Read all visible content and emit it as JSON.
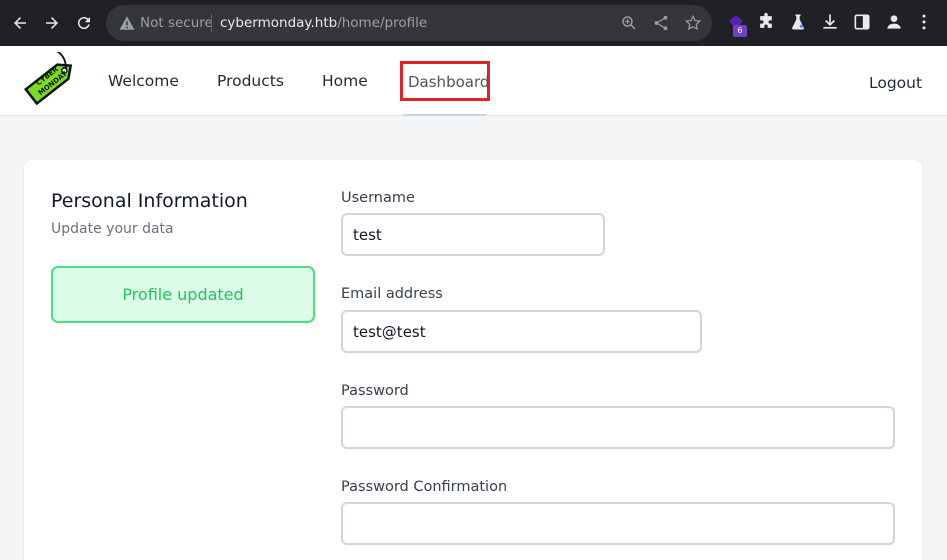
{
  "browser": {
    "security_label": "Not secure",
    "url_host": "cybermonday.htb",
    "url_path": "/home/profile",
    "extension_badge": "6"
  },
  "site": {
    "logo_text": "CYBER MONDAY",
    "nav": {
      "welcome": "Welcome",
      "products": "Products",
      "home": "Home",
      "dashboard": "Dashboard"
    },
    "logout": "Logout"
  },
  "profile": {
    "title": "Personal Information",
    "subtitle": "Update your data",
    "alert": "Profile updated",
    "fields": {
      "username": {
        "label": "Username",
        "value": "test"
      },
      "email": {
        "label": "Email address",
        "value": "test@test"
      },
      "password": {
        "label": "Password",
        "value": ""
      },
      "password_confirmation": {
        "label": "Password Confirmation",
        "value": ""
      }
    }
  },
  "colors": {
    "chrome_bg": "#202124",
    "highlight_box": "#e02424",
    "success_bg": "#dcfce7",
    "success_border": "#4ade80",
    "success_text": "#22c55e",
    "logo_green": "#7ddc1f"
  }
}
